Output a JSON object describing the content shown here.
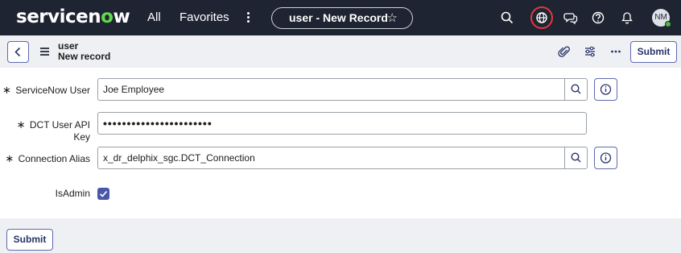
{
  "nav": {
    "logo_prefix": "servicen",
    "logo_o": "o",
    "logo_suffix": "w",
    "all_label": "All",
    "favorites_label": "Favorites",
    "record_pill": "user - New Record",
    "star": "☆",
    "avatar_initials": "NM"
  },
  "record_header": {
    "table": "user",
    "subtitle": "New record",
    "submit_label": "Submit"
  },
  "form": {
    "required_mark": "∗",
    "fields": [
      {
        "label": "ServiceNow User",
        "value": "Joe Employee"
      },
      {
        "label": "DCT User API Key",
        "value": "•••••••••••••••••••••••"
      },
      {
        "label": "Connection Alias",
        "value": "x_dr_delphix_sgc.DCT_Connection"
      }
    ],
    "is_admin_label": "IsAdmin",
    "is_admin_checked": true
  },
  "footer": {
    "submit_label": "Submit"
  },
  "colors": {
    "nav_bg": "#1f2432",
    "logo_accent": "#62d84e",
    "primary": "#4a56a8",
    "highlight_ring": "#e0393e"
  }
}
